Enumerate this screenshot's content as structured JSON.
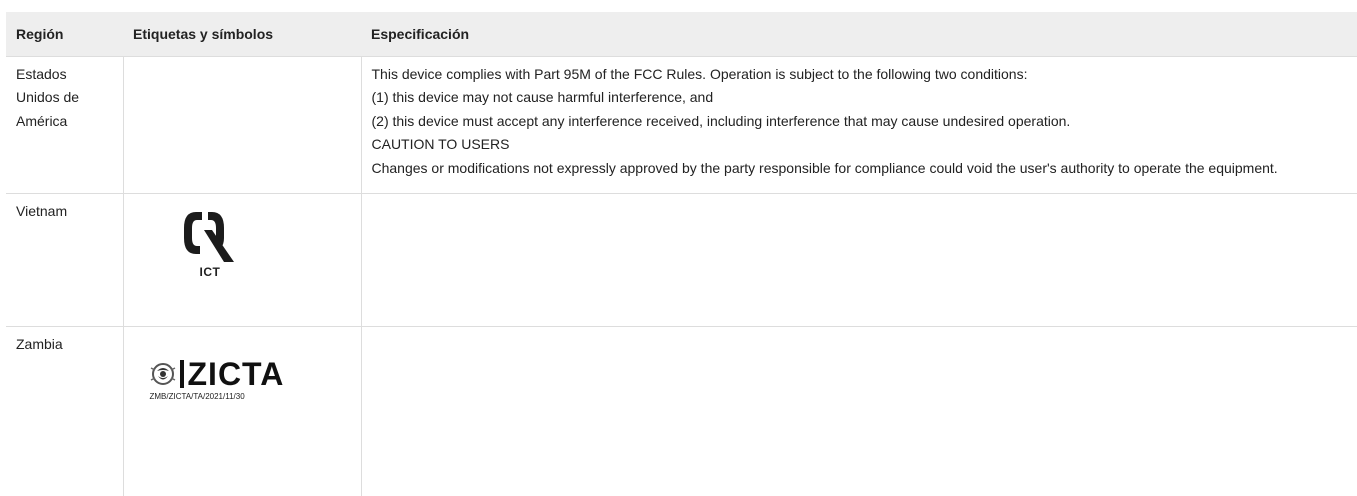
{
  "table": {
    "headers": [
      "Región",
      "Etiquetas y símbolos",
      "Especificación"
    ],
    "rows": [
      {
        "region": "Estados Unidos de América",
        "spec_lines": [
          "This device complies with Part 95M of the FCC Rules. Operation is subject to the following two conditions:",
          "(1) this device may not cause harmful interference, and",
          "(2) this device must accept any interference received, including interference that may cause undesired operation.",
          "CAUTION TO USERS",
          "Changes or modifications not expressly approved by the party responsible for compliance could void the user's authority to operate the equipment."
        ]
      },
      {
        "region": "Vietnam",
        "logo": {
          "icon": "ict-quality-mark-icon",
          "text": "ICT"
        }
      },
      {
        "region": "Zambia",
        "logo": {
          "icon": "zicta-emblem-icon",
          "text": "ZICTA",
          "registration": "ZMB/ZICTA/TA/2021/11/30"
        }
      }
    ]
  }
}
